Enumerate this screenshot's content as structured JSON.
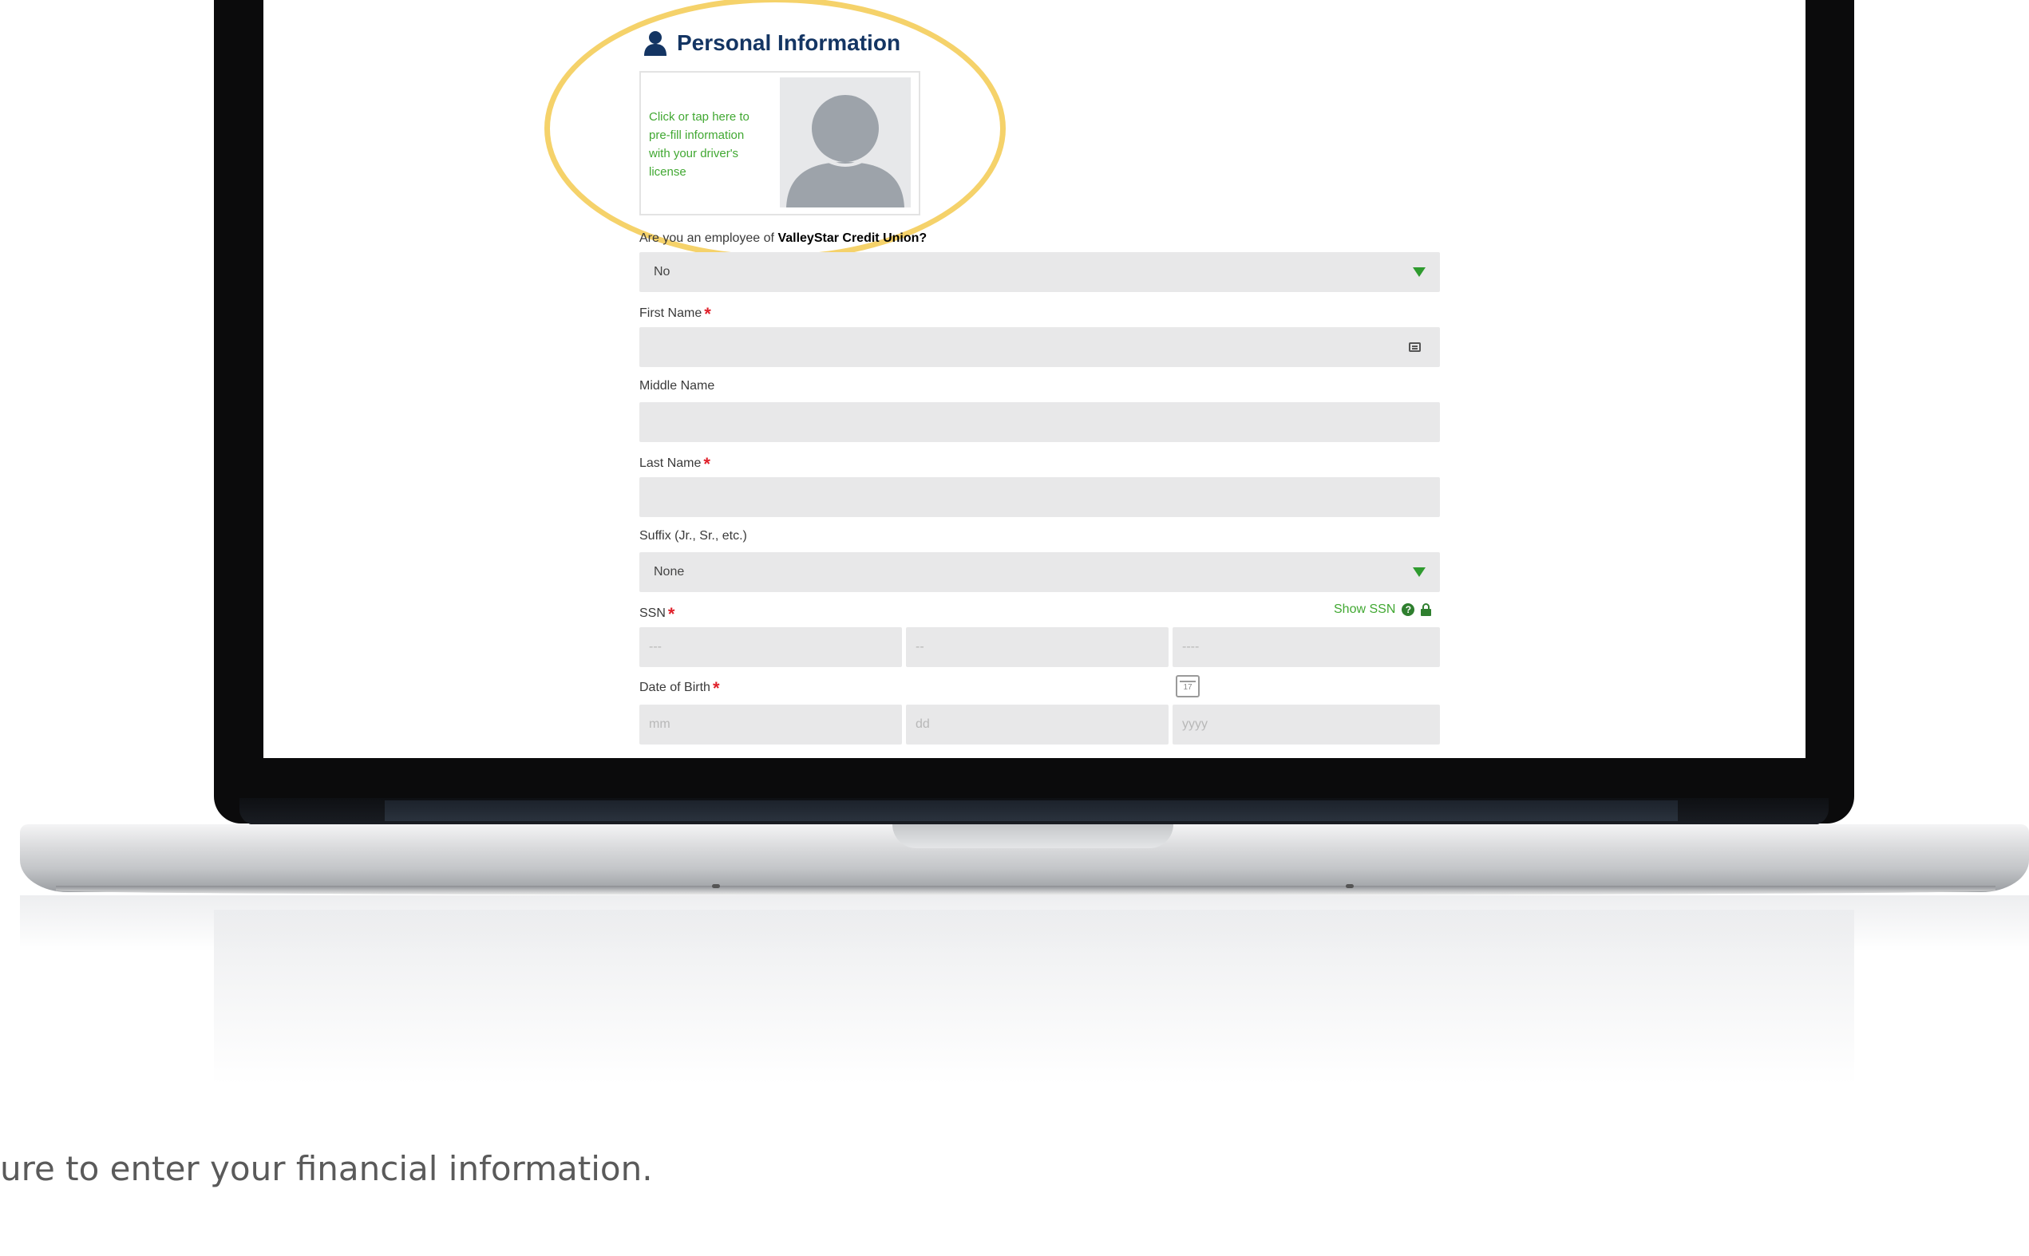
{
  "form": {
    "section_title": "Personal Information",
    "license_prompt": "Click or tap here to pre-fill information with your driver's license",
    "employee_question_prefix": "Are you an employee of",
    "employee_question_org": "ValleyStar Credit Union?",
    "employee_value": "No",
    "first_name_label": "First Name",
    "first_name_value": "",
    "middle_name_label": "Middle Name",
    "middle_name_value": "",
    "last_name_label": "Last Name",
    "last_name_value": "",
    "suffix_label": "Suffix (Jr., Sr., etc.)",
    "suffix_value": "None",
    "ssn_label": "SSN",
    "show_ssn_label": "Show SSN",
    "ssn_placeholders": [
      "---",
      "--",
      "----"
    ],
    "dob_label": "Date of Birth",
    "dob_placeholders": [
      "mm",
      "dd",
      "yyyy"
    ],
    "calendar_day": "17",
    "required_marker": "*"
  },
  "caption": "ure to enter your financial information.",
  "colors": {
    "accent_green": "#41a832",
    "title_navy": "#143563",
    "required_red": "#e0202a",
    "highlight_yellow": "#f5d26a",
    "field_gray": "#e8e8e9"
  },
  "icons": [
    "person-icon",
    "avatar-silhouette-icon",
    "chevron-down-icon",
    "contact-card-icon",
    "help-icon",
    "lock-icon",
    "calendar-icon"
  ]
}
